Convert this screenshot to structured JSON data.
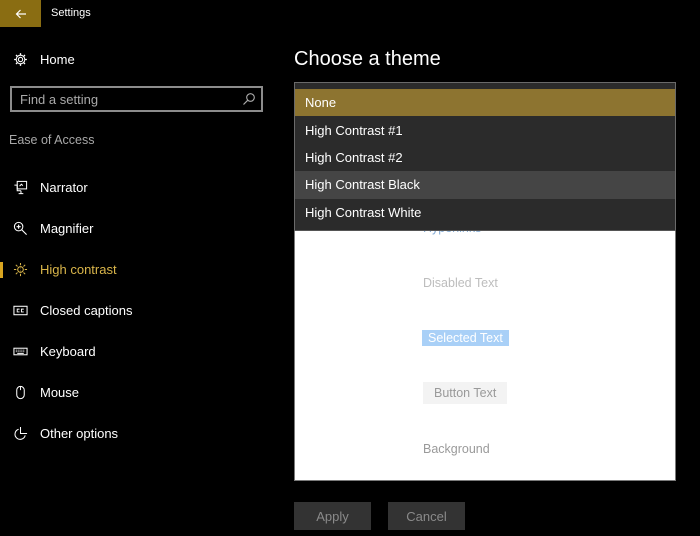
{
  "window": {
    "title": "Settings",
    "accent_color": "#8a6d12"
  },
  "sidebar": {
    "home_label": "Home",
    "search_placeholder": "Find a setting",
    "section_label": "Ease of Access",
    "items": [
      {
        "label": "Narrator",
        "icon": "narrator-icon",
        "active": false
      },
      {
        "label": "Magnifier",
        "icon": "magnifier-icon",
        "active": false
      },
      {
        "label": "High contrast",
        "icon": "high-contrast-icon",
        "active": true
      },
      {
        "label": "Closed captions",
        "icon": "closed-captions-icon",
        "active": false
      },
      {
        "label": "Keyboard",
        "icon": "keyboard-icon",
        "active": false
      },
      {
        "label": "Mouse",
        "icon": "mouse-icon",
        "active": false
      },
      {
        "label": "Other options",
        "icon": "other-options-icon",
        "active": false
      }
    ],
    "active_color": "#d9b54a"
  },
  "main": {
    "title": "Choose a theme",
    "theme_dropdown": {
      "options": [
        "None",
        "High Contrast #1",
        "High Contrast #2",
        "High Contrast Black",
        "High Contrast White"
      ],
      "selected": "None",
      "hovered": "High Contrast Black"
    },
    "preview": {
      "hyperlink": "Hyperlinks",
      "disabled_text": "Disabled Text",
      "selected_text": "Selected Text",
      "button_text": "Button Text",
      "background": "Background"
    },
    "buttons": {
      "apply": "Apply",
      "cancel": "Cancel"
    }
  }
}
